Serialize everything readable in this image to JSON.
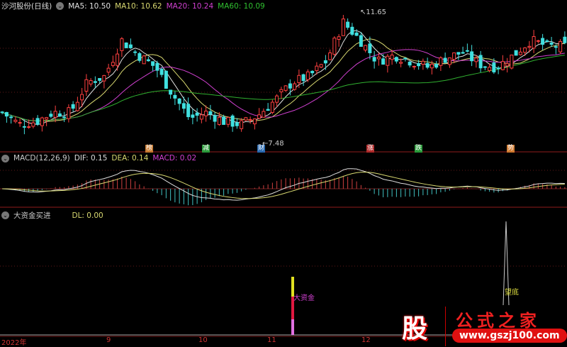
{
  "header": {
    "title": "沙河股份(日线)",
    "ma5": "MA5: 10.50",
    "ma10": "MA10: 10.62",
    "ma20": "MA20: 10.24",
    "ma60": "MA60: 10.09"
  },
  "price_labels": {
    "high": "11.65",
    "low": "7.48"
  },
  "markers": [
    {
      "text": "榜",
      "color": "#c87a30"
    },
    {
      "text": "减",
      "color": "#2a9a3a"
    },
    {
      "text": "财",
      "color": "#2a6ab0"
    },
    {
      "text": "涨",
      "color": "#b02a2a"
    },
    {
      "text": "跌",
      "color": "#2a9a3a"
    },
    {
      "text": "势",
      "color": "#d07a30"
    }
  ],
  "macd": {
    "title": "MACD(12,26,9)",
    "dif": "DIF: 0.15",
    "dea": "DEA: 0.14",
    "macd": "MACD: 0.02"
  },
  "dl": {
    "title": "大资金买进",
    "dl": "DL: 0.00",
    "signal1": "大资金",
    "signal2": "望底"
  },
  "x_axis": [
    "2022年",
    "9",
    "10",
    "11",
    "12"
  ],
  "watermark": {
    "logo": "股",
    "name": "公式之家",
    "url": "www.gszj100.com"
  },
  "colors": {
    "ma5": "#e0e0e0",
    "ma10": "#d8d870",
    "ma20": "#d040d0",
    "ma60": "#30b030",
    "up": "#ff4040",
    "down": "#40e0e0"
  },
  "chart_data": {
    "type": "candlestick",
    "close_keypoints": [
      8.4,
      8.0,
      8.1,
      8.4,
      8.4,
      9.4,
      9.6,
      10.8,
      10.3,
      9.9,
      9.0,
      8.2,
      8.4,
      8.1,
      8.0,
      8.3,
      8.8,
      9.4,
      9.6,
      10.1,
      11.4,
      10.8,
      10.1,
      10.3,
      10.1,
      9.9,
      10.2,
      10.4,
      10.0,
      9.9,
      10.3,
      10.8,
      10.6,
      10.6
    ],
    "ylim": [
      7.3,
      11.9
    ]
  }
}
